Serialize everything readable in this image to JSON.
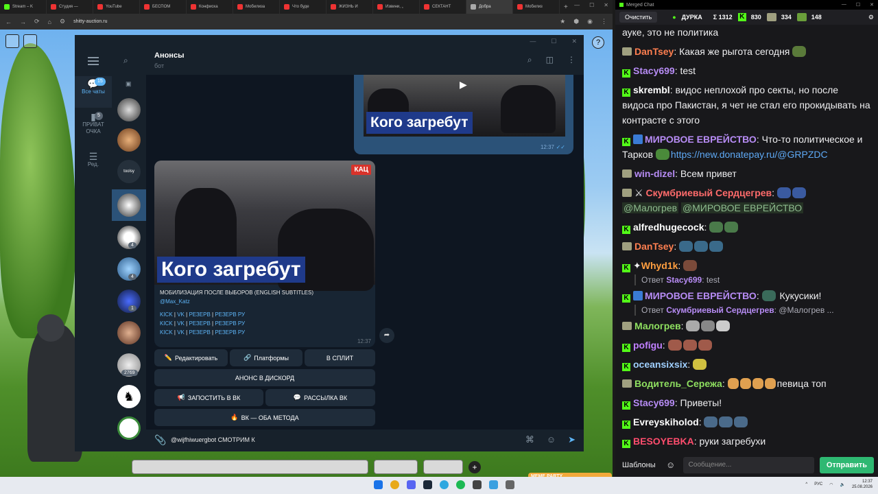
{
  "browser": {
    "tabs": [
      "Stream – K",
      "Студия —",
      "YouTube",
      "БЕСПОМ",
      "Конфиска",
      "Мобилиза",
      "Что буде",
      "ЖИЗНЬ И",
      "Извини, „",
      "СЕКТАНТ",
      "Добра",
      "Мобилиз"
    ],
    "address": "shitty-auction.ru",
    "new_tab": "+"
  },
  "telegram": {
    "rail": [
      {
        "label": "Все чаты",
        "badge": "15"
      },
      {
        "label": "ПРИВАТ ОЧКА",
        "badge": "5"
      },
      {
        "label": "Ред.",
        "badge": ""
      }
    ],
    "list_badges": [
      "4",
      "4",
      "1",
      "2769"
    ],
    "list_avatar_text": "toolsy",
    "header": {
      "title": "Анонсы",
      "subtitle": "бот"
    },
    "prev_message": {
      "overlay": "Кого загребут",
      "time": "12:37"
    },
    "main_message": {
      "overlay": "Кого загребут",
      "badge": "КАЦ",
      "title": "МОБИЛИЗАЦИЯ ПОСЛЕ ВЫБОРОВ (ENGLISH SUBTITLES)",
      "mention": "@Max_Katz",
      "links": [
        "KICK",
        "VK",
        "РЕЗЕРВ",
        "РЕЗЕРВ РУ"
      ],
      "sep": "|",
      "time": "12:37"
    },
    "buttons": {
      "edit": "Редактировать",
      "platforms": "Платформы",
      "split": "В СПЛИТ",
      "discord": "АНОНС В ДИСКОРД",
      "post_vk": "ЗАПОСТИТЬ В ВК",
      "mailing": "РАССЫЛКА ВК",
      "vk_both": "ВК — ОБА МЕТОДА"
    },
    "input_value": "@wijfhiwuergbot СМОТРИМ К"
  },
  "game": {
    "meme_label": "MEME PARTY"
  },
  "taskbar": {
    "lang": "РУС",
    "time": "12:37",
    "date": "25.08.2026"
  },
  "chat": {
    "window_title": "Merged Chat",
    "clear_label": "Очистить",
    "stream_name": "ДУРКА",
    "stats": {
      "total": "Σ 1312",
      "kick": "830",
      "twitch": "334",
      "vk": "148"
    },
    "messages": [
      {
        "user": "",
        "text": "ауке, это не политика",
        "color": "#efeff1"
      },
      {
        "user": "DanTsey",
        "text": "Какая же рыгота сегодня",
        "color": "#ff7f50"
      },
      {
        "user": "Stacy699",
        "text": "test",
        "color": "#b78cf5"
      },
      {
        "user": "skrembl",
        "text": "видос неплохой про секты, но после видоса про Пакистан, я чет не стал его прокидывать на контрасте с этого",
        "color": "#ffffff"
      },
      {
        "user": "МИРОВОЕ ЕВРЕЙСТВО",
        "text": "Что-то политическое и Тарков",
        "link": "https://new.donatepay.ru/@GRPZDC",
        "color": "#b78cf5"
      },
      {
        "user": "win-dizel",
        "text": "Всем привет",
        "color": "#b78cf5"
      },
      {
        "user": "Скумбриевый Сердцегрев",
        "text": "",
        "tags": [
          "@Малогрев",
          "@МИРОВОЕ ЕВРЕЙСТВО"
        ],
        "color": "#ff6b6b"
      },
      {
        "user": "alfredhugecock",
        "text": "",
        "color": "#ffffff"
      },
      {
        "user": "DanTsey",
        "text": "",
        "color": "#ff7f50"
      },
      {
        "user": "Whyd1k",
        "text": "",
        "color": "#ff9f40"
      },
      {
        "reply_prefix": "Ответ",
        "reply_user": "Stacy699",
        "reply_text": "test"
      },
      {
        "user": "МИРОВОЕ ЕВРЕЙСТВО",
        "text": "Кукусики!",
        "color": "#b78cf5"
      },
      {
        "reply_prefix": "Ответ",
        "reply_user": "Скумбриевый Сердцегрев",
        "reply_text": "@Малогрев ..."
      },
      {
        "user": "Малогрев",
        "text": "",
        "color": "#8fe060"
      },
      {
        "user": "pofigu",
        "text": "",
        "color": "#c080ff"
      },
      {
        "user": "oceansixsix",
        "text": "",
        "color": "#a0d0ff"
      },
      {
        "user": "Водитель_Сережа",
        "text": "певица топ",
        "color": "#8fe060"
      },
      {
        "user": "Stacy699",
        "text": "Приветы!",
        "color": "#b78cf5"
      },
      {
        "user": "Evreyskiholod",
        "text": "",
        "color": "#ffffff"
      },
      {
        "user": "BESOYEBKA",
        "text": "руки загребухи",
        "color": "#ff4d6d"
      }
    ],
    "templates_label": "Шаблоны",
    "input_placeholder": "Сообщение...",
    "send_label": "Отправить"
  },
  "colors": {
    "kick": "#53fc18",
    "telegram_accent": "#5eb5f7",
    "send_green": "#2eb872"
  }
}
